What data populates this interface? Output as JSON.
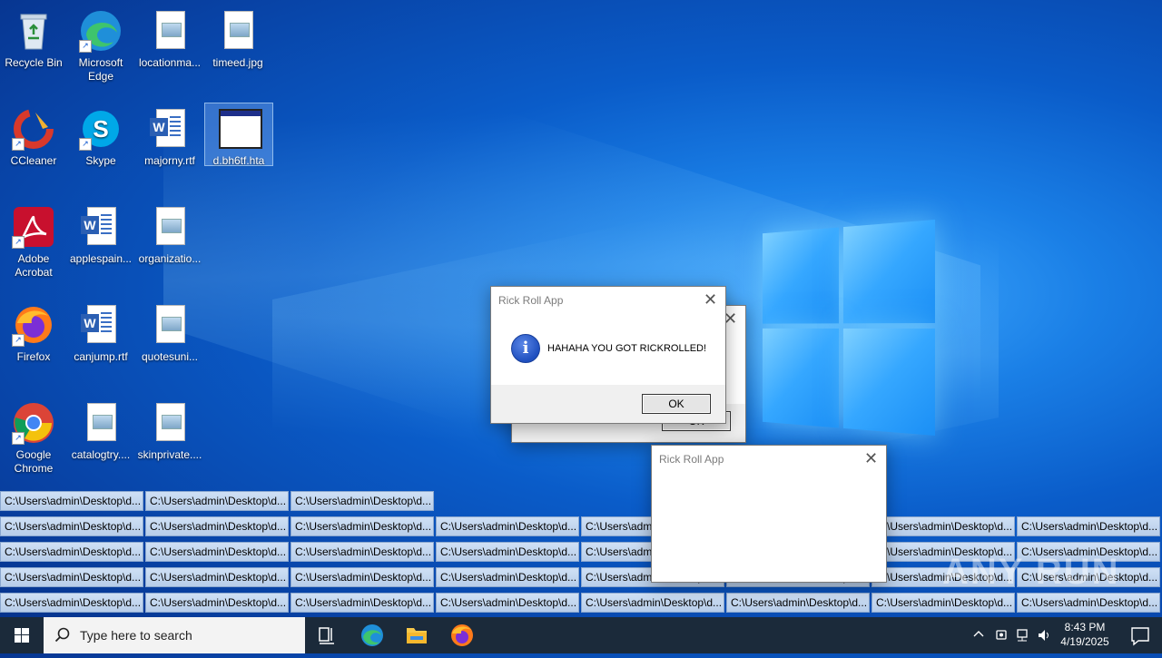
{
  "desktop": {
    "icons": [
      {
        "label": "Recycle Bin",
        "type": "recycle"
      },
      {
        "label": "Microsoft Edge",
        "type": "edge"
      },
      {
        "label": "locationma...",
        "type": "image"
      },
      {
        "label": "timeed.jpg",
        "type": "image"
      },
      {
        "label": "CCleaner",
        "type": "ccleaner"
      },
      {
        "label": "Skype",
        "type": "skype"
      },
      {
        "label": "majorny.rtf",
        "type": "word"
      },
      {
        "label": "d.bh6tf.hta",
        "type": "hta"
      },
      {
        "label": "Adobe Acrobat",
        "type": "acrobat"
      },
      {
        "label": "applespain...",
        "type": "word"
      },
      {
        "label": "organizatio...",
        "type": "image"
      },
      {
        "label": "Firefox",
        "type": "firefox"
      },
      {
        "label": "canjump.rtf",
        "type": "word"
      },
      {
        "label": "quotesuni...",
        "type": "image"
      },
      {
        "label": "Google Chrome",
        "type": "chrome"
      },
      {
        "label": "catalogtry....",
        "type": "image"
      },
      {
        "label": "skinprivate....",
        "type": "image"
      }
    ]
  },
  "strip_label": "C:\\Users\\admin\\Desktop\\d...",
  "dialogs": {
    "main": {
      "title": "Rick Roll App",
      "message": "HAHAHA YOU GOT RICKROLLED!",
      "ok_label": "OK",
      "close_glyph": "✕"
    },
    "behind": {
      "ok_label": "OK",
      "close_glyph": "✕"
    },
    "empty": {
      "title": "Rick Roll App",
      "close_glyph": "✕"
    }
  },
  "taskbar": {
    "search_placeholder": "Type here to search",
    "time": "8:43 PM",
    "date": "4/19/2025"
  },
  "watermark": "ANY RUN",
  "colors": {
    "taskbar": "#1b2a3a",
    "strip_bg": "#b7cde9",
    "dialog_footer": "#f0f0f0"
  }
}
